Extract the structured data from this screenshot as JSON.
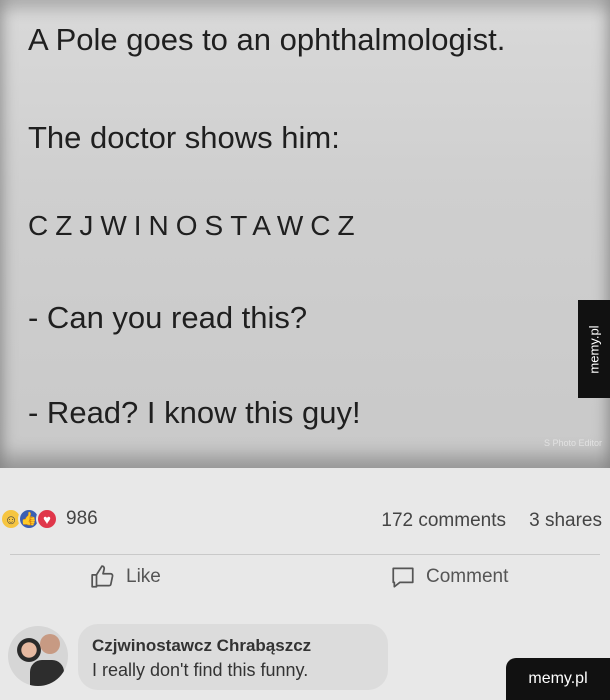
{
  "post": {
    "line1": "A Pole goes to an ophthalmologist.",
    "line2": "The doctor shows him:",
    "chart_letters": "CZJWINOSTAWCZ",
    "line4": "- Can you read this?",
    "line5": "- Read? I know this guy!",
    "photo_editor_mark": "S Photo Editor"
  },
  "watermark": {
    "side": "memy.pl",
    "corner": "memy.pl"
  },
  "stats": {
    "reaction_icons": [
      "haha-icon",
      "like-icon",
      "love-icon"
    ],
    "reaction_count": "986",
    "comments": "172 comments",
    "shares": "3 shares"
  },
  "actions": {
    "like_label": "Like",
    "comment_label": "Comment"
  },
  "comment": {
    "author": "Czjwinostawcz Chrabąszcz",
    "text": "I really don't find this funny."
  }
}
